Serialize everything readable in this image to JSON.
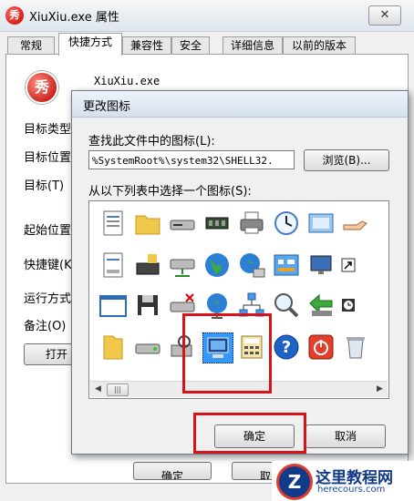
{
  "window": {
    "title": "XiuXiu.exe 属性",
    "close_glyph": "✕",
    "app_icon_glyph": "秀"
  },
  "tabs": [
    "常规",
    "快捷方式",
    "兼容性",
    "安全",
    "详细信息",
    "以前的版本"
  ],
  "active_tab_index": 1,
  "shortcut": {
    "filename": "XiuXiu.exe",
    "labels": [
      "目标类型",
      "目标位置",
      "目标(T)",
      "起始位置",
      "快捷键(K",
      "运行方式",
      "备注(O)"
    ],
    "open_button": "打开",
    "ok_button_partial": "确定",
    "cancel_button_partial": "取消"
  },
  "dialog": {
    "title": "更改图标",
    "search_label": "查找此文件中的图标(L):",
    "path_value": "%SystemRoot%\\system32\\SHELL32.",
    "browse_button": "浏览(B)...",
    "list_label": "从以下列表中选择一个图标(S):",
    "ok_button": "确定",
    "cancel_button": "取消",
    "scroll_left_glyph": "◀",
    "scroll_right_glyph": "▶",
    "scroll_thumb_glyph": "|||",
    "icons": [
      [
        "document-icon",
        "folder-icon",
        "removable-drive-icon",
        "memory-chip-icon",
        "printer-icon",
        "clock-icon",
        "window-frame-icon",
        "hand-share-icon"
      ],
      [
        "text-file-icon",
        "server-icon",
        "network-drive-icon",
        "globe-icon",
        "globe-network-icon",
        "control-panel-icon",
        "monitor-settings-icon",
        "shortcut-arrow-icon"
      ],
      [
        "blank-window-icon",
        "floppy-disk-icon",
        "drive-x-icon",
        "network-globe-icon",
        "network-tree-icon",
        "magnifier-icon",
        "back-arrow-icon",
        "clock-small-icon"
      ],
      [
        "folder-icon",
        "hard-drive-icon",
        "computer-search-icon",
        "computer-monitor-icon",
        "calculator-icon",
        "help-icon",
        "power-icon",
        "recycle-bin-icon"
      ]
    ],
    "selected_icon": "computer-monitor-icon"
  },
  "watermark": {
    "logo_glyph": "Z",
    "title": "这里教程网",
    "subtitle": "herecours.com"
  },
  "colors": {
    "highlight_red": "#d7141a",
    "selection_blue": "#3399ff"
  }
}
